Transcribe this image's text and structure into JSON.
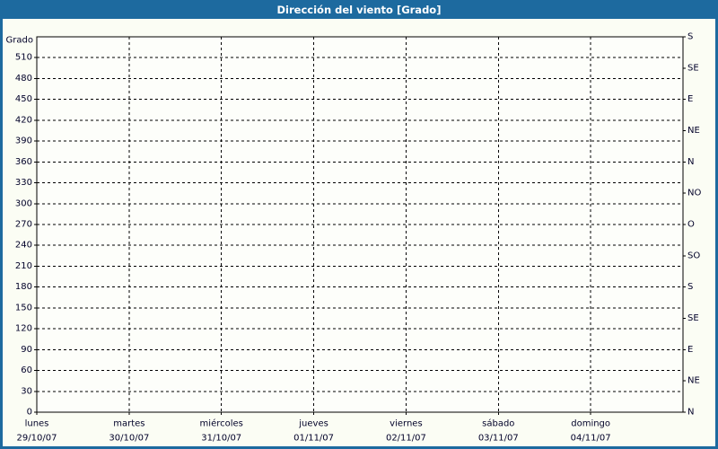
{
  "window": {
    "title": "Dirección del viento [Grado]",
    "colors": {
      "title_bar": "#1d6a9f",
      "title_text": "#ffffff",
      "border": "#1d6a9f",
      "background": "#fbfdf4",
      "plot_background": "#fdfefa",
      "axis_line": "#000000",
      "grid_line": "#000000",
      "label_text": "#000028"
    }
  },
  "chart_data": {
    "type": "line",
    "title": "Dirección del viento [Grado]",
    "grid": true,
    "series": [],
    "y_axis": {
      "label": "Grado",
      "min": 0,
      "max": 540,
      "tick_step": 30,
      "ticks": [
        0,
        30,
        60,
        90,
        120,
        150,
        180,
        210,
        240,
        270,
        300,
        330,
        360,
        390,
        420,
        450,
        480,
        510
      ]
    },
    "y_axis_right": {
      "unit": "compass",
      "labels": [
        {
          "deg": 540,
          "label": "S"
        },
        {
          "deg": 495,
          "label": "SE"
        },
        {
          "deg": 450,
          "label": "E"
        },
        {
          "deg": 405,
          "label": "NE"
        },
        {
          "deg": 360,
          "label": "N"
        },
        {
          "deg": 315,
          "label": "NO"
        },
        {
          "deg": 270,
          "label": "O"
        },
        {
          "deg": 225,
          "label": "SO"
        },
        {
          "deg": 180,
          "label": "S"
        },
        {
          "deg": 135,
          "label": "SE"
        },
        {
          "deg": 90,
          "label": "E"
        },
        {
          "deg": 45,
          "label": "NE"
        },
        {
          "deg": 0,
          "label": "N"
        }
      ]
    },
    "x_axis": {
      "days": [
        {
          "name": "lunes",
          "date": "29/10/07"
        },
        {
          "name": "martes",
          "date": "30/10/07"
        },
        {
          "name": "miércoles",
          "date": "31/10/07"
        },
        {
          "name": "jueves",
          "date": "01/11/07"
        },
        {
          "name": "viernes",
          "date": "02/11/07"
        },
        {
          "name": "sábado",
          "date": "03/11/07"
        },
        {
          "name": "domingo",
          "date": "04/11/07"
        }
      ]
    }
  }
}
